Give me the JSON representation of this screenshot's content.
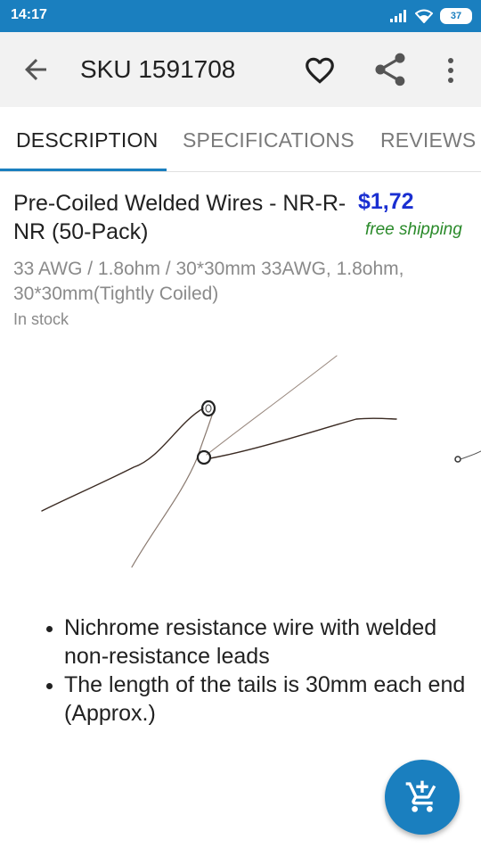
{
  "status_bar": {
    "time": "14:17",
    "battery": "37"
  },
  "app_bar": {
    "title": "SKU 1591708"
  },
  "tabs": [
    {
      "label": "DESCRIPTION"
    },
    {
      "label": "SPECIFICATIONS"
    },
    {
      "label": "REVIEWS ("
    }
  ],
  "product": {
    "title": "Pre-Coiled Welded Wires - NR-R-NR (50-Pack)",
    "price": "$1,72",
    "shipping": "free shipping",
    "variant": "33 AWG / 1.8ohm / 30*30mm 33AWG, 1.8ohm, 30*30mm(Tightly Coiled)",
    "stock": "In stock"
  },
  "bullets": [
    "Nichrome resistance wire with welded non-resistance leads",
    "The length of the tails is 30mm each end (Approx.)"
  ],
  "icons": {
    "back": "arrow-back-icon",
    "favorite": "heart-outline-icon",
    "share": "share-icon",
    "more": "more-vert-icon",
    "fab": "add-shopping-cart-icon"
  },
  "colors": {
    "accent": "#1a7fbf",
    "price": "#1a2fd1",
    "shipping": "#2a8a2a"
  }
}
